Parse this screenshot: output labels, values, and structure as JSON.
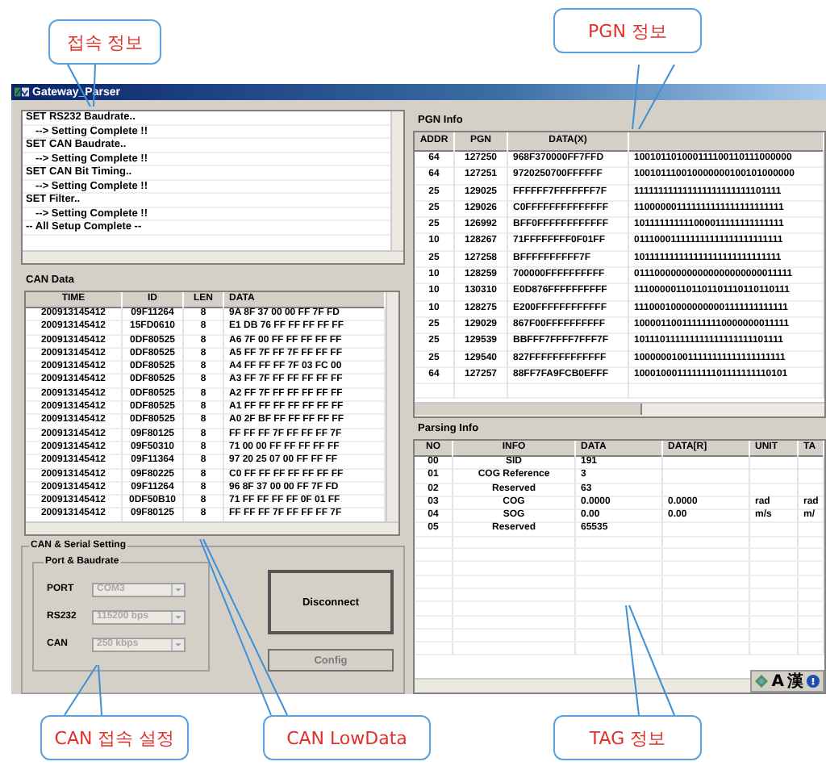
{
  "window": {
    "title": "Gateway_Parser"
  },
  "log": [
    {
      "kind": "command",
      "text": "SET RS232 Baudrate.."
    },
    {
      "kind": "result",
      "text": "--> Setting Complete !!"
    },
    {
      "kind": "command",
      "text": "SET CAN Baudrate.."
    },
    {
      "kind": "result",
      "text": "--> Setting Complete !!"
    },
    {
      "kind": "command",
      "text": "SET CAN Bit Timing.."
    },
    {
      "kind": "result",
      "text": "--> Setting Complete !!"
    },
    {
      "kind": "command",
      "text": "SET Filter.."
    },
    {
      "kind": "result",
      "text": "--> Setting Complete !!"
    },
    {
      "kind": "command",
      "text": "-- All Setup Complete --"
    }
  ],
  "can_data": {
    "title": "CAN Data",
    "columns": [
      "TIME",
      "ID",
      "LEN",
      "DATA"
    ],
    "rows": [
      [
        "200913145412",
        "09F11264",
        "8",
        "9A 8F 37 00 00 FF 7F FD"
      ],
      [
        "200913145412",
        "15FD0610",
        "8",
        "E1 DB 76 FF FF FF FF FF"
      ],
      [
        "200913145412",
        "0DF80525",
        "8",
        "A6 7F 00 FF FF FF FF FF"
      ],
      [
        "200913145412",
        "0DF80525",
        "8",
        "A5 FF 7F FF 7F FF FF FF"
      ],
      [
        "200913145412",
        "0DF80525",
        "8",
        "A4 FF FF FF 7F 03 FC 00"
      ],
      [
        "200913145412",
        "0DF80525",
        "8",
        "A3 FF 7F FF FF FF FF FF"
      ],
      [
        "200913145412",
        "0DF80525",
        "8",
        "A2 FF 7F FF FF FF FF FF"
      ],
      [
        "200913145412",
        "0DF80525",
        "8",
        "A1 FF FF FF FF FF FF FF"
      ],
      [
        "200913145412",
        "0DF80525",
        "8",
        "A0 2F BF FF FF FF FF FF"
      ],
      [
        "200913145412",
        "09F80125",
        "8",
        "FF FF FF 7F FF FF FF 7F"
      ],
      [
        "200913145412",
        "09F50310",
        "8",
        "71 00 00 FF FF FF FF FF"
      ],
      [
        "200913145412",
        "09F11364",
        "8",
        "97 20 25 07 00 FF FF FF"
      ],
      [
        "200913145412",
        "09F80225",
        "8",
        "C0 FF FF FF FF FF FF FF"
      ],
      [
        "200913145412",
        "09F11264",
        "8",
        "96 8F 37 00 00 FF 7F FD"
      ],
      [
        "200913145412",
        "0DF50B10",
        "8",
        "71 FF FF FF FF 0F 01 FF"
      ],
      [
        "200913145412",
        "09F80125",
        "8",
        "FF FF FF 7F FF FF FF 7F"
      ]
    ]
  },
  "settings": {
    "title": "CAN & Serial Setting",
    "group": "Port & Baudrate",
    "fields": [
      {
        "label": "PORT",
        "value": "COM3",
        "disabled": true
      },
      {
        "label": "RS232",
        "value": "115200 bps",
        "disabled": true
      },
      {
        "label": "CAN",
        "value": "250 kbps",
        "disabled": true
      }
    ],
    "buttons": [
      {
        "label": "Disconnect",
        "disabled": false
      },
      {
        "label": "Config",
        "disabled": true
      }
    ]
  },
  "pgn_info": {
    "title": "PGN Info",
    "columns": [
      "ADDR",
      "PGN",
      "DATA(X)"
    ],
    "rows": [
      [
        "64",
        "127250",
        "968F370000FF7FFD",
        "100101101000111100110111000000"
      ],
      [
        "64",
        "127251",
        "9720250700FFFFFF",
        "100101110010000000100101000000"
      ],
      [
        "25",
        "129025",
        "FFFFFF7FFFFFFF7F",
        "111111111111111111111111101111"
      ],
      [
        "25",
        "129026",
        "C0FFFFFFFFFFFFFF",
        "110000001111111111111111111111"
      ],
      [
        "25",
        "126992",
        "BFF0FFFFFFFFFFFF",
        "101111111111000011111111111111"
      ],
      [
        "10",
        "128267",
        "71FFFFFFFF0F01FF",
        "011100011111111111111111111111"
      ],
      [
        "25",
        "127258",
        "BFFFFFFFFFF7F",
        "101111111111111111111111111111"
      ],
      [
        "10",
        "128259",
        "700000FFFFFFFFFF",
        "011100000000000000000000011111"
      ],
      [
        "10",
        "130310",
        "E0D876FFFFFFFFFF",
        "111000001101101101110110110111"
      ],
      [
        "10",
        "128275",
        "E200FFFFFFFFFFFF",
        "111000100000000001111111111111"
      ],
      [
        "25",
        "129029",
        "867F00FFFFFFFFFF",
        "100001100111111110000000011111"
      ],
      [
        "25",
        "129539",
        "BBFFF7FFFF7FFF7F",
        "101110111111111111111111101111"
      ],
      [
        "25",
        "129540",
        "827FFFFFFFFFFFFF",
        "100000010011111111111111111111"
      ],
      [
        "64",
        "127257",
        "88FF7FA9FCB0EFFF",
        "100010001111111101111111110101"
      ]
    ]
  },
  "parsing_info": {
    "title": "Parsing Info",
    "columns": [
      "NO",
      "INFO",
      "DATA",
      "DATA[R]",
      "UNIT",
      "TA"
    ],
    "rows": [
      [
        "00",
        "SID",
        "191",
        "",
        "",
        ""
      ],
      [
        "01",
        "COG Reference",
        "3",
        "",
        "",
        ""
      ],
      [
        "02",
        "Reserved",
        "63",
        "",
        "",
        ""
      ],
      [
        "03",
        "COG",
        "0.0000",
        "0.0000",
        "rad",
        "rad"
      ],
      [
        "04",
        "SOG",
        "0.00",
        "0.00",
        "m/s",
        "m/"
      ],
      [
        "05",
        "Reserved",
        "65535",
        "",
        "",
        ""
      ]
    ]
  },
  "language_bar": [
    "A",
    "漢"
  ],
  "callouts": [
    {
      "text": "접속 정보"
    },
    {
      "text": "PGN 정보"
    },
    {
      "text": "CAN 접속 설정"
    },
    {
      "text": "CAN LowData"
    },
    {
      "text": "TAG 정보"
    }
  ]
}
